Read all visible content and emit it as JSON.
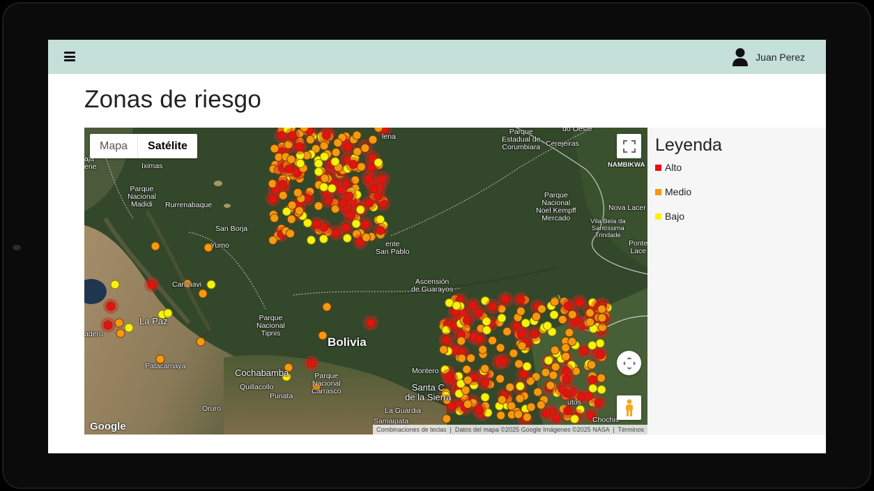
{
  "header": {
    "menu_icon": "hamburger-icon",
    "user_icon": "user-icon",
    "user_name": "Juan Perez"
  },
  "page": {
    "title": "Zonas de riesgo"
  },
  "map": {
    "type_controls": {
      "map_label": "Mapa",
      "satellite_label": "Satélite",
      "selected": "Satélite"
    },
    "controls": {
      "fullscreen_icon": "fullscreen-icon",
      "pan_icon": "pan-arrows-icon",
      "pegman_icon": "pegman-icon"
    },
    "attribution": {
      "shortcuts": "Combinaciones de teclas",
      "data": "Datos del mapa ©2025 Google Imágenes ©2025 NASA",
      "terms": "Términos"
    },
    "logo": "Google",
    "place_labels": [
      "Parque\nEstadual de\nCorumbiara",
      "Cerejeiras",
      "NAMBIKWA",
      "do Oeste",
      "lena",
      "Iximas",
      "Parque\nNacional\nMadidi",
      "Rurrenabaque",
      "San Borja",
      "Yumo",
      "Parque\nNacional\nNoel Kempff\nMercado",
      "Vila Bela da\nSantíssima\nTrindade",
      "Nova Lacer",
      "Ponte\nLace",
      "ente\nSan Pablo",
      "Ascensión\nde Guarayos",
      "Caranavi",
      "La Paz",
      "adero",
      "Parque\nNacional\nTipnis",
      "Bolivia",
      "Patacamaya",
      "Cochabamba",
      "Quillacollo",
      "Punata",
      "Parque\nNacional\nCarrasco",
      "Oruro",
      "Montero",
      "Santa C\nde la Sierra",
      "La Guardia",
      "Samaipata",
      "Chochis",
      "utos",
      "aja",
      "ene"
    ]
  },
  "legend": {
    "title": "Leyenda",
    "items": [
      {
        "label": "Alto",
        "color": "#e8100e"
      },
      {
        "label": "Medio",
        "color": "#f59a0f"
      },
      {
        "label": "Bajo",
        "color": "#f7f20e"
      }
    ]
  },
  "colors": {
    "header_bg": "#c5dfd9",
    "alto": "#e8100e",
    "medio": "#f59a0f",
    "bajo": "#f7f20e"
  }
}
